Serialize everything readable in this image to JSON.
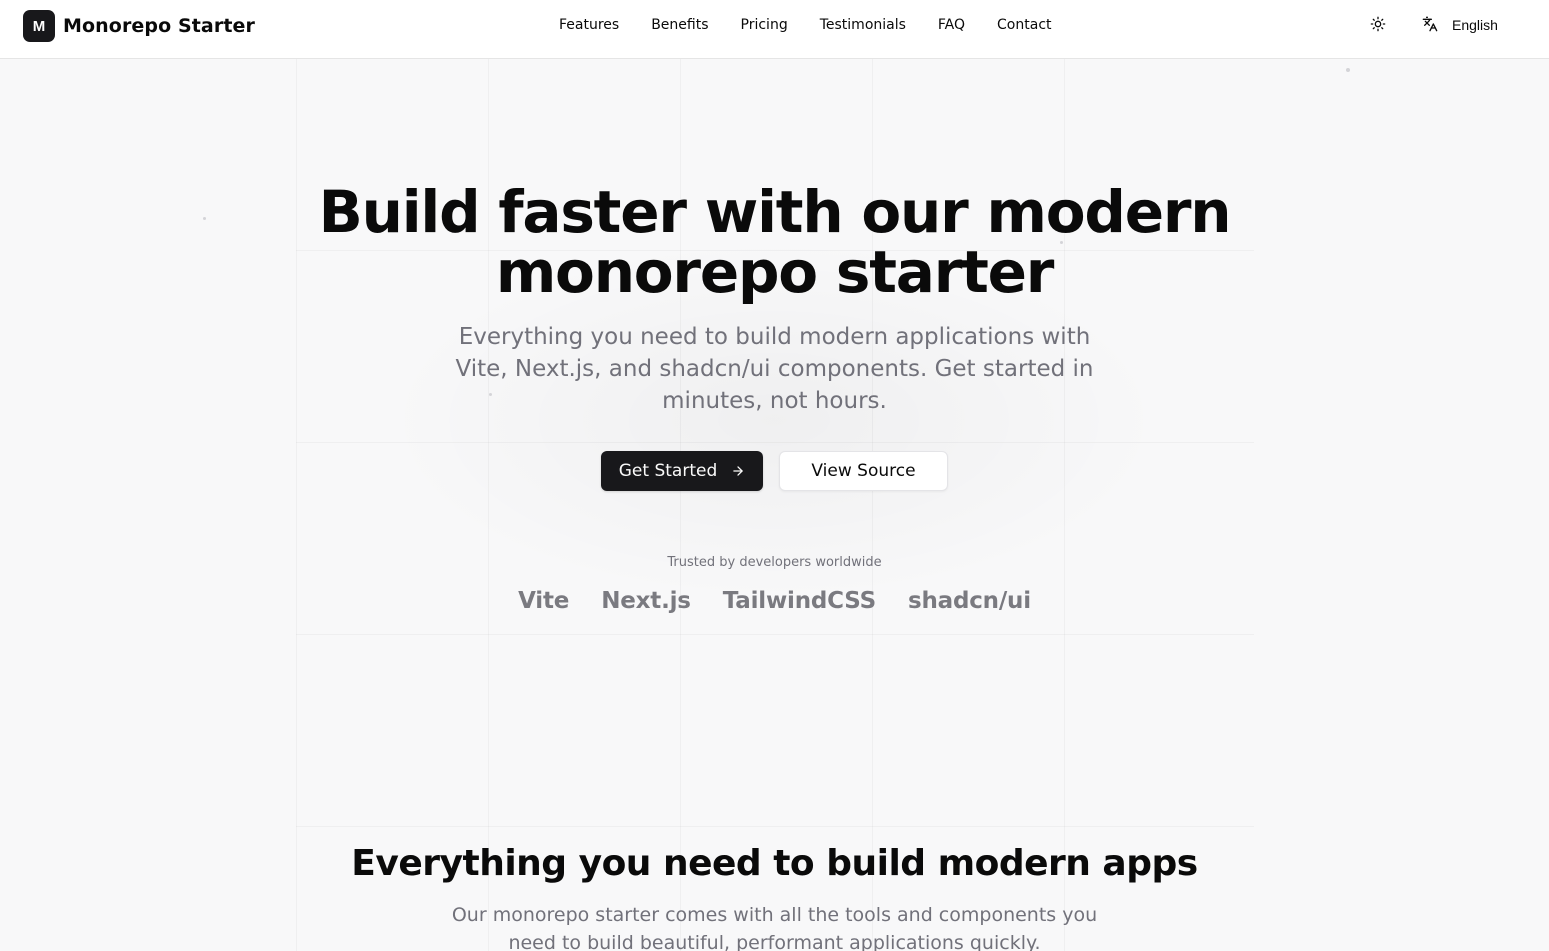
{
  "brand": {
    "logo_letter": "M",
    "name": "Monorepo Starter"
  },
  "nav": {
    "items": [
      {
        "label": "Features"
      },
      {
        "label": "Benefits"
      },
      {
        "label": "Pricing"
      },
      {
        "label": "Testimonials"
      },
      {
        "label": "FAQ"
      },
      {
        "label": "Contact"
      }
    ]
  },
  "header_controls": {
    "theme_icon": "sun-icon",
    "language_icon": "translate-icon",
    "language_label": "English"
  },
  "hero": {
    "title_line1": "Build faster with our modern",
    "title_line2": "monorepo starter",
    "subtitle": "Everything you need to build modern applications with Vite, Next.js, and shadcn/ui components. Get started in minutes, not hours.",
    "primary_cta": "Get Started",
    "primary_cta_icon": "arrow-right-icon",
    "secondary_cta": "View Source",
    "trusted_label": "Trusted by developers worldwide",
    "logos": [
      "Vite",
      "Next.js",
      "TailwindCSS",
      "shadcn/ui"
    ]
  },
  "features_section": {
    "title": "Everything you need to build modern apps",
    "subtitle": "Our monorepo starter comes with all the tools and components you need to build beautiful, performant applications quickly."
  },
  "colors": {
    "primary": "#18181b",
    "muted_text": "#71717a",
    "background": "#fafafa"
  }
}
